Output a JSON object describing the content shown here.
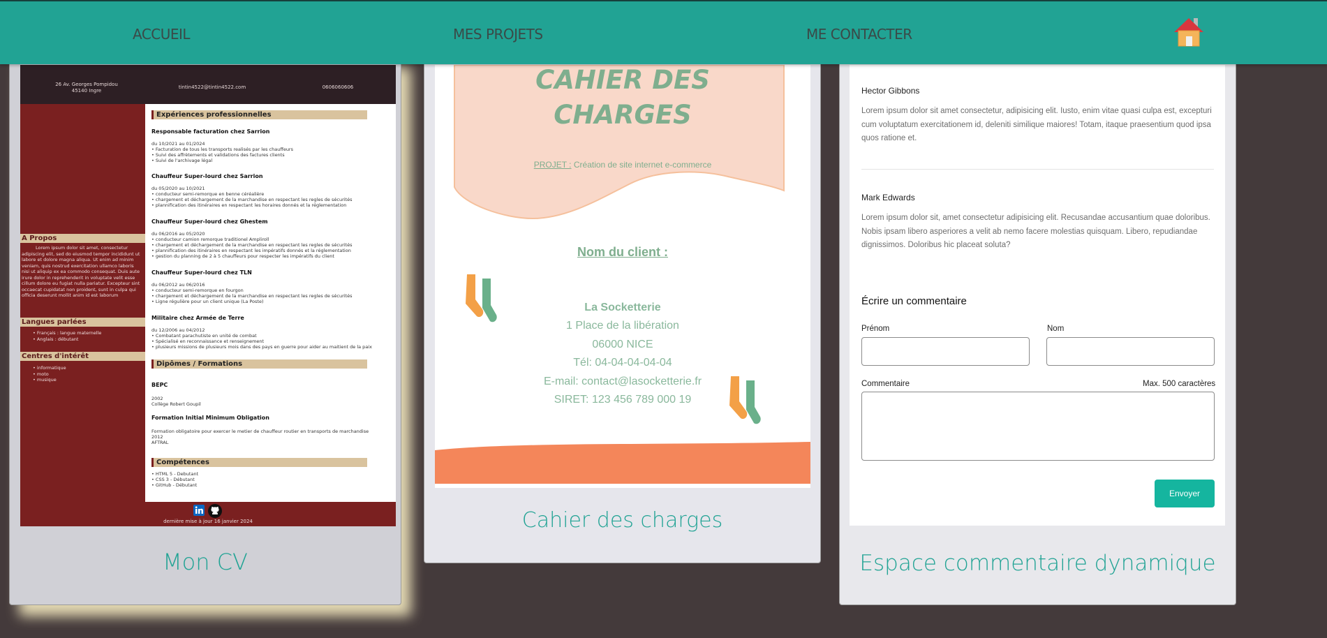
{
  "nav": {
    "links": [
      "ACCUEIL",
      "MES PROJETS",
      "ME CONTACTER"
    ],
    "home_icon": "home-icon"
  },
  "cards": [
    {
      "title": "Mon CV"
    },
    {
      "title": "Cahier des charges"
    },
    {
      "title": "Espace commentaire dynamique"
    }
  ],
  "cv": {
    "address_line1": "26 Av. Georges Pompidou",
    "address_line2": "45140 Ingre",
    "email": "tintin4522@tintin4522.com",
    "phone": "0606060606",
    "sections": {
      "experience": "Expériences professionnelles",
      "diplomas": "Dipômes / Formations",
      "skills": "Compétences",
      "about": "A Propos",
      "languages": "Langues parlées",
      "interests": "Centres d'intérêt"
    },
    "jobs": [
      {
        "title": "Responsable facturation chez Sarrion",
        "dates": "du 10/2021 au 01/2024",
        "items": "• Facturation de tous les transports realisés par les chauffeurs\n• Suivi des affrètements et validations des factures clients\n• Suivi de l'archivage légal"
      },
      {
        "title": "Chauffeur Super-lourd chez Sarrion",
        "dates": "du 05/2020 au 10/2021",
        "items": "• conducteur semi-remorque en benne céréalière\n• chargement et déchargement de la marchandise en respectant les regles de sécurités\n• plannification des itinéraires en respectant les horaires donnés et la réglementation"
      },
      {
        "title": "Chauffeur Super-lourd chez Ghestem",
        "dates": "du 06/2016 au 05/2020",
        "items": "• conducteur camion remorque traditionel Ampliroll\n• chargement et déchargement de la marchandise en respectant les regles de sécurités\n• plannification des itinéraires en respectant les impératifs donnés et la réglementation\n• gestion du planning de 2 à 5 chauffeurs pour respecter les impératifs du client"
      },
      {
        "title": "Chauffeur Super-lourd chez TLN",
        "dates": "du 06/2012 au 06/2016",
        "items": "• conducteur semi-remorque en fourgon\n• chargement et déchargement de la marchandise en respectant les regles de sécurités\n• Ligne régulière pour un client unique (La Poste)"
      },
      {
        "title": "Militaire chez Armée de Terre",
        "dates": "du 12/2006 au 04/2012",
        "items": "• Combatant parachutiste en unité de combat\n• Spécialisé en reconnaissance et renseignement\n• plusieurs missions de plusieurs mois dans des pays en guerre pour aider au maitient de la paix"
      }
    ],
    "diplomas": [
      {
        "title": "BEPC",
        "details": "2002\nCollège Robert Goupil"
      },
      {
        "title": "Formation Initial Minimum Obligation",
        "details": "Formation obligatoire pour exercer le metier de chauffeur routier en transports de marchandise\n2012\nAFTRAL"
      }
    ],
    "skills": "• HTML 5 - Debutant\n• CSS 3 - Débutant\n• GitHub - Débutant",
    "about_text": "Lorem ipsum dolor sit amet, consectetur adipiscing elit, sed do eiusmod tempor incididunt ut labore et dolore magna aliqua. Ut enim ad minim veniam, quis nostrud exercitation ullamco laboris nisi ut aliquip ex ea commodo consequat. Duis aute irure dolor in reprehenderit in voluptate velit esse cillum dolore eu fugiat nulla pariatur. Excepteur sint occaecat cupidatat non proident, sunt in culpa qui officia deserunt mollit anim id est laborum",
    "languages": "• Français : langue maternelle\n• Anglais : débutant",
    "interests": "• informatique\n• moto\n• musique",
    "footer": "dernière mise à jour 16 janvier 2024"
  },
  "cdc": {
    "title_line1": "CAHIER DES",
    "title_line2": "CHARGES",
    "project_label": "PROJET :",
    "project_value": "Création de site internet e-commerce",
    "client_label": "Nom du client :",
    "client_name": "La Socketterie",
    "address": "1 Place de la libération",
    "city": "06000 NICE",
    "phone": "Tél: 04-04-04-04-04",
    "email": "E-mail: contact@lasocketterie.fr",
    "siret": "SIRET: 123 456 789 000 19"
  },
  "comments": {
    "list": [
      {
        "author": "Hector Gibbons",
        "text": "Lorem ipsum dolor sit amet consectetur, adipisicing elit. Iusto, enim vitae quasi culpa est, excepturi cum voluptatum exercitationem id, deleniti similique maiores! Totam, itaque praesentium quod ipsa quos ratione et."
      },
      {
        "author": "Mark Edwards",
        "text": "Lorem ipsum dolor sit, amet consectetur adipisicing elit. Recusandae accusantium quae doloribus. Nobis ipsam libero asperiores a velit ab nemo facere molestias quisquam. Libero, repudiandae dignissimos. Doloribus hic placeat soluta?"
      }
    ],
    "form_title": "Écrire un commentaire",
    "firstname_label": "Prénom",
    "lastname_label": "Nom",
    "comment_label": "Commentaire",
    "max_label": "Max. 500 caractères",
    "submit_label": "Envoyer"
  }
}
